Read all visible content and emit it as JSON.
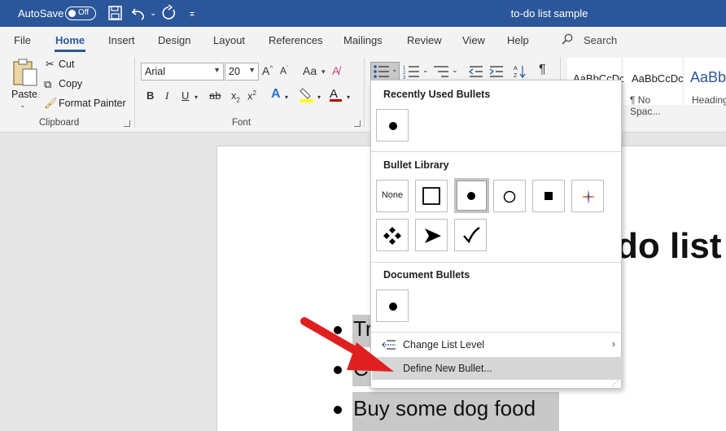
{
  "titlebar": {
    "autosave_label": "AutoSave",
    "toggle_state": "Off",
    "doc_title": "to-do list sample"
  },
  "tabs": [
    "File",
    "Home",
    "Insert",
    "Design",
    "Layout",
    "References",
    "Mailings",
    "Review",
    "View",
    "Help"
  ],
  "active_tab": "Home",
  "search": {
    "label": "Search"
  },
  "clipboard": {
    "paste": "Paste",
    "cut": "Cut",
    "copy": "Copy",
    "format_painter": "Format Painter",
    "group_label": "Clipboard"
  },
  "font": {
    "name": "Arial",
    "size": "20",
    "group_label": "Font",
    "bold": "B",
    "italic": "I",
    "underline": "U",
    "strike": "ab",
    "subscript": "x",
    "superscript": "x"
  },
  "styles": [
    {
      "sample": "AaBbCcDc",
      "name": ""
    },
    {
      "sample": "AaBbCcDc",
      "name": "¶ No Spac..."
    },
    {
      "sample": "AaBb",
      "name": "Heading"
    }
  ],
  "dropdown": {
    "recent_title": "Recently Used Bullets",
    "library_title": "Bullet Library",
    "library_none": "None",
    "document_title": "Document Bullets",
    "change_level": "Change List Level",
    "define_new": "Define New Bullet..."
  },
  "document": {
    "heading_visible": "do list",
    "items": [
      "Tr",
      "C",
      "Buy some dog food"
    ]
  },
  "colors": {
    "title_bar": "#2b579a",
    "accent": "#2b579a",
    "highlight_yellow": "#ffff00",
    "font_color_red": "#c00000",
    "arrow_red": "#e02020"
  }
}
